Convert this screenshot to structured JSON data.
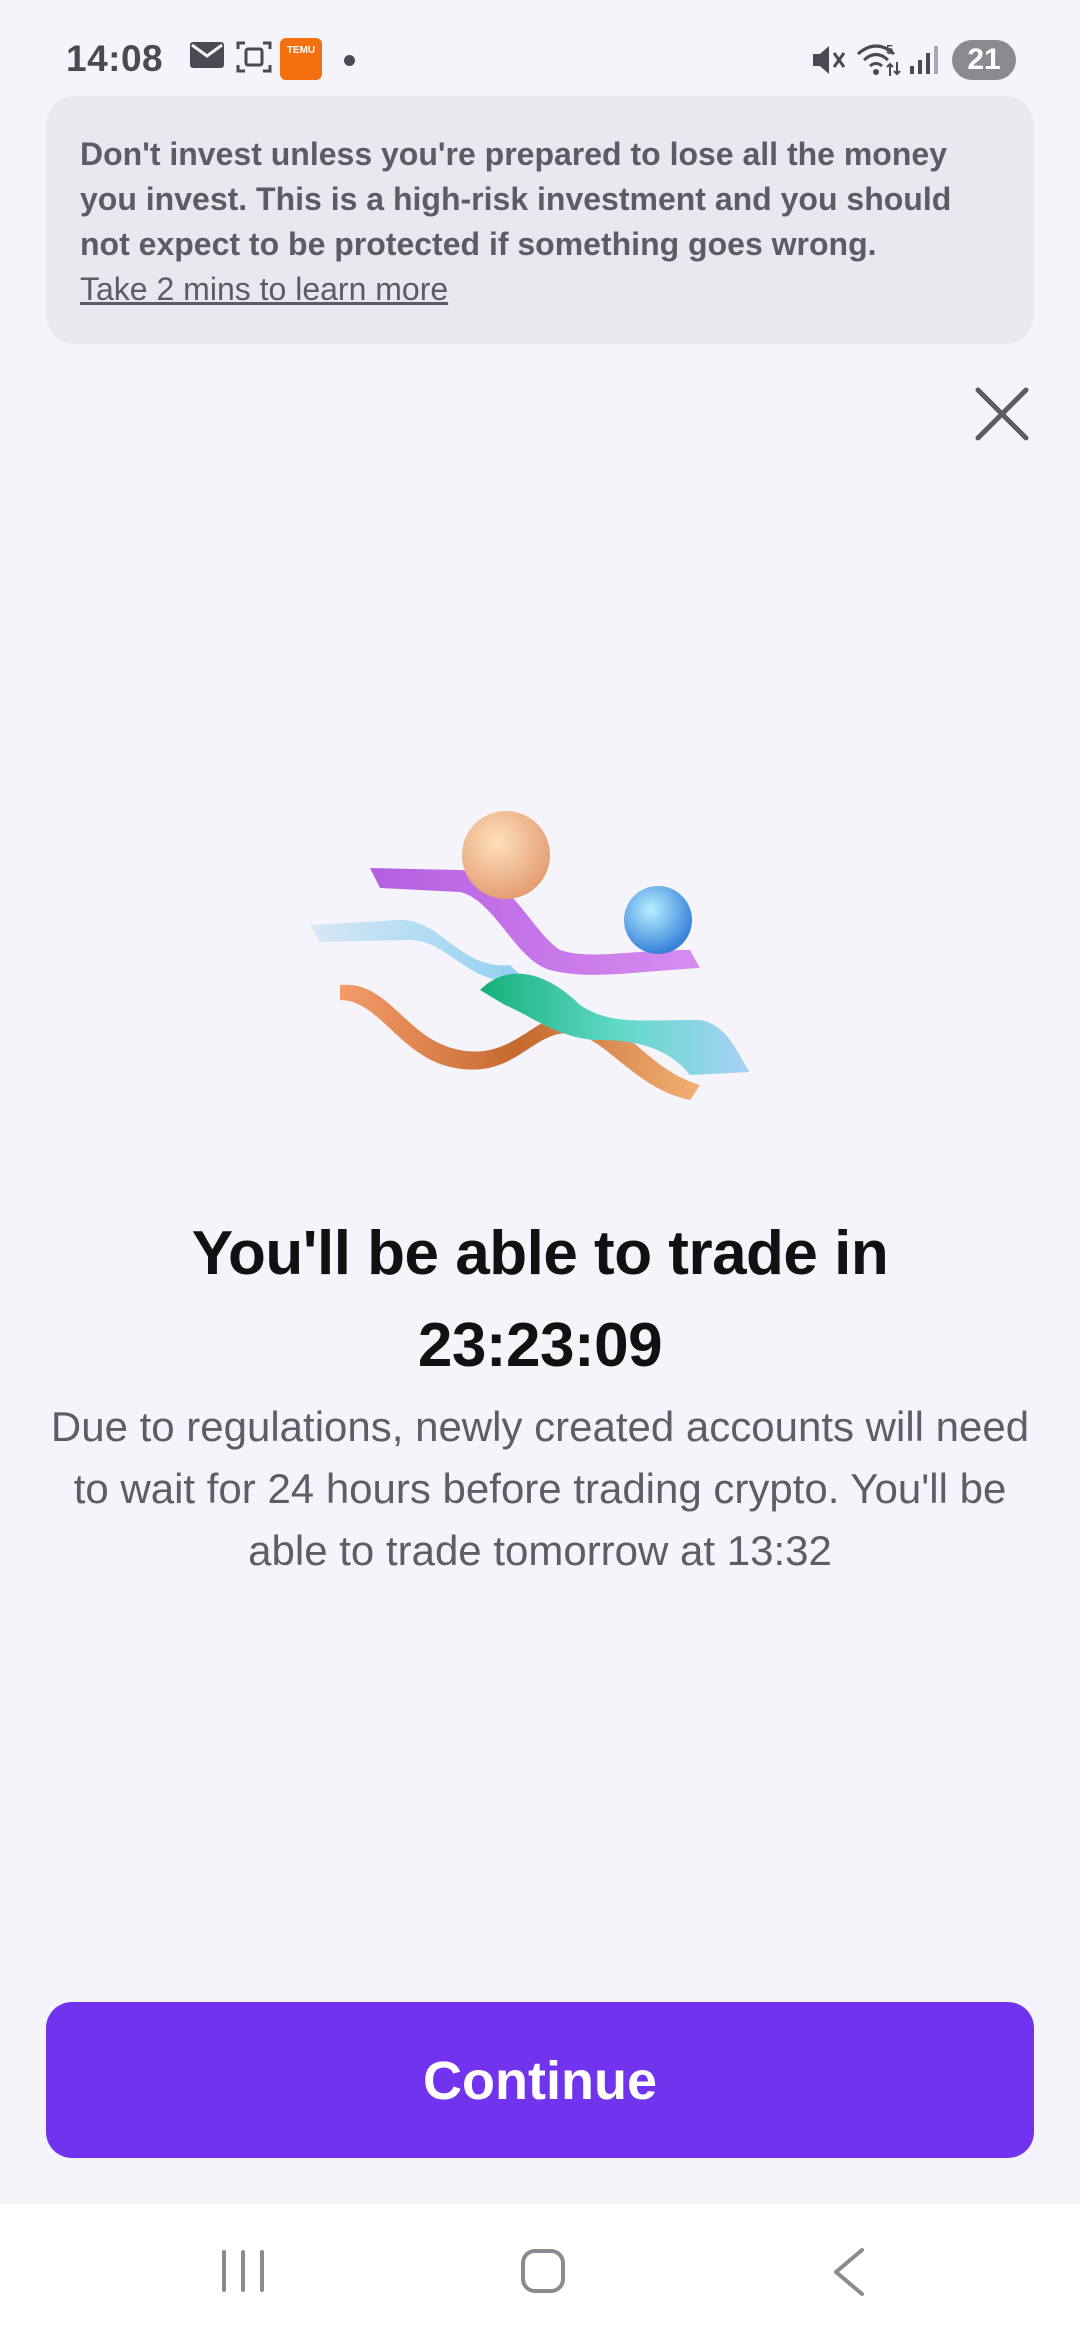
{
  "status_bar": {
    "time": "14:08",
    "icons": [
      "mail-icon",
      "screenshot-icon",
      "temu-icon",
      "dot-icon",
      "mute-icon",
      "wifi-icon",
      "signal-icon"
    ],
    "temu_label": "TEMU",
    "battery": "21"
  },
  "risk_banner": {
    "text": "Don't invest unless you're prepared to lose all the money you invest. This is a high-risk investment and you should not expect to be protected if something goes wrong.",
    "link": "Take 2 mins to learn more"
  },
  "main": {
    "title": "You'll be able to trade in",
    "countdown": "23:23:09",
    "description": "Due to regulations, newly created accounts will need to wait for 24 hours before trading crypto. You'll be able to trade tomorrow at 13:32"
  },
  "continue_button": {
    "label": "Continue"
  },
  "colors": {
    "accent": "#7233ef",
    "background": "#f5f4fa",
    "banner": "#e8e8ee"
  },
  "nav_bar": {
    "icons": [
      "recents-icon",
      "home-icon",
      "back-icon"
    ]
  }
}
